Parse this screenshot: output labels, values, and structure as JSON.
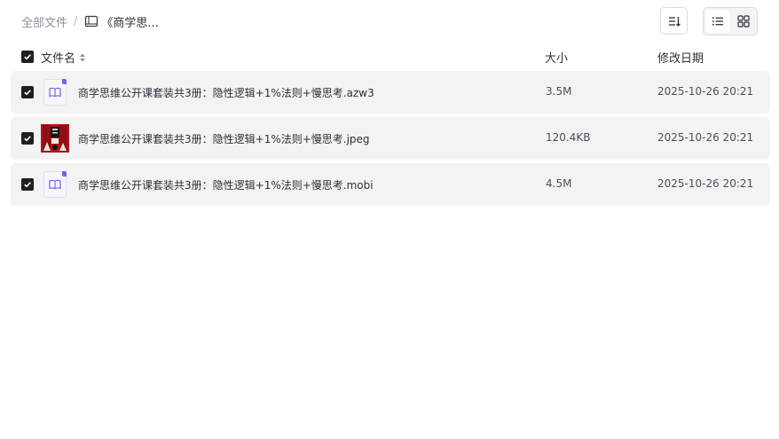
{
  "breadcrumb": {
    "root": "全部文件",
    "separator": "/",
    "current": "《商学思..."
  },
  "icons": {
    "breadcrumb_folder": "book-icon",
    "sort": "sort-descending-icon",
    "list_view": "list-view-icon",
    "grid_view": "grid-view-icon",
    "checkbox": "checkbox-checked-icon",
    "ebook": "ebook-icon",
    "image_thumb": "book-cover-thumbnail"
  },
  "colors": {
    "accent": "#7b5ce6",
    "row_bg": "#f3f3f4",
    "checkbox": "#1f1f23"
  },
  "table": {
    "columns": {
      "name": "文件名",
      "size": "大小",
      "modified": "修改日期"
    },
    "rows": [
      {
        "name": "商学思维公开课套装共3册：隐性逻辑+1%法则+慢思考.azw3",
        "size": "3.5M",
        "modified": "2025-10-26 20:21",
        "type": "ebook"
      },
      {
        "name": "商学思维公开课套装共3册：隐性逻辑+1%法则+慢思考.jpeg",
        "size": "120.4KB",
        "modified": "2025-10-26 20:21",
        "type": "image"
      },
      {
        "name": "商学思维公开课套装共3册：隐性逻辑+1%法则+慢思考.mobi",
        "size": "4.5M",
        "modified": "2025-10-26 20:21",
        "type": "ebook"
      }
    ]
  }
}
